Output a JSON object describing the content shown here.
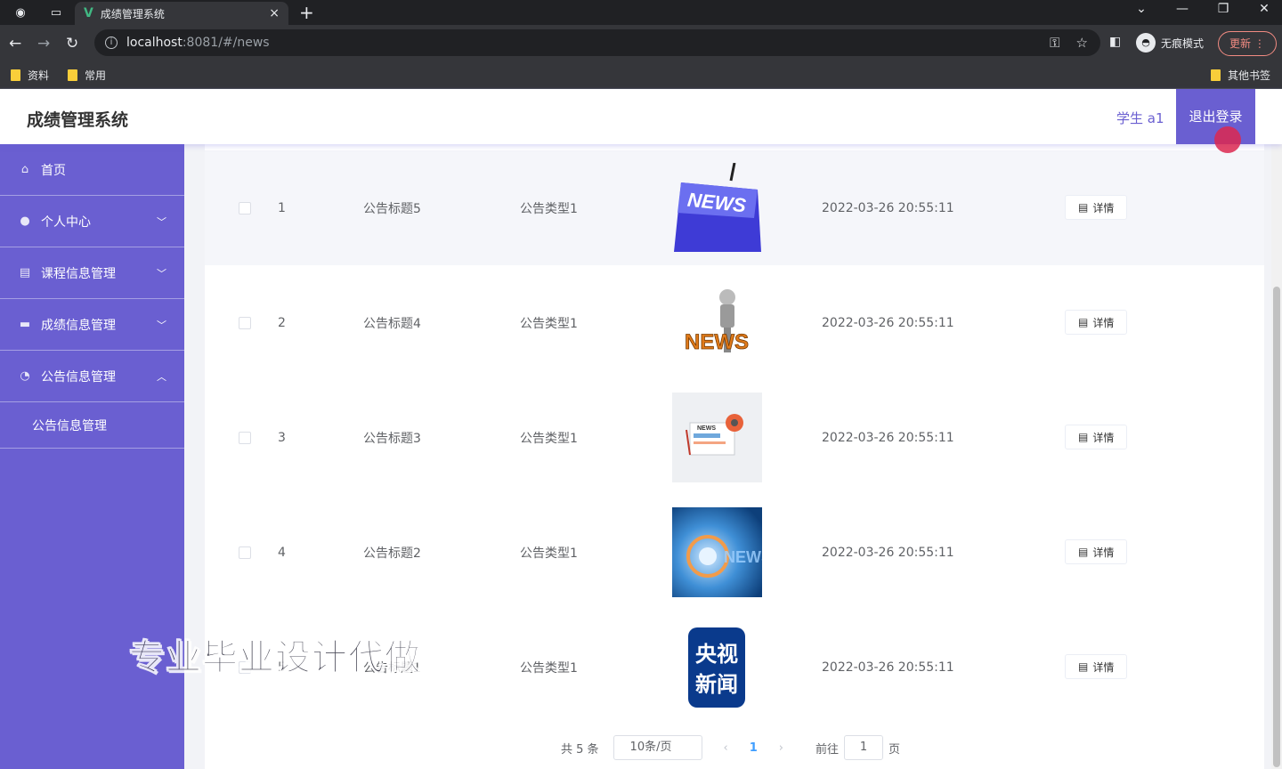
{
  "browser": {
    "tab_title": "成绩管理系统",
    "tab_close": "×",
    "new_tab": "+",
    "url_host": "localhost",
    "url_rest": ":8081/#/news",
    "incognito_label": "无痕模式",
    "update_label": "更新",
    "bookmarks": [
      "资料",
      "常用"
    ],
    "other_bookmarks": "其他书签"
  },
  "header": {
    "brand": "成绩管理系统",
    "user": "学生 a1",
    "logout": "退出登录"
  },
  "sidebar": {
    "items": [
      {
        "label": "首页",
        "icon": "home-icon"
      },
      {
        "label": "个人中心",
        "icon": "user-icon",
        "arrow": "﹀"
      },
      {
        "label": "课程信息管理",
        "icon": "book-icon",
        "arrow": "﹀"
      },
      {
        "label": "成绩信息管理",
        "icon": "grade-icon",
        "arrow": "﹀"
      },
      {
        "label": "公告信息管理",
        "icon": "notice-icon",
        "arrow": "︿"
      }
    ],
    "sub_item": "公告信息管理"
  },
  "table": {
    "rows": [
      {
        "index": "1",
        "title": "公告标题5",
        "type": "公告类型1",
        "image": "news-key-image",
        "time": "2022-03-26 20:55:11",
        "action": "详情"
      },
      {
        "index": "2",
        "title": "公告标题4",
        "type": "公告类型1",
        "image": "news-3d-image",
        "time": "2022-03-26 20:55:11",
        "action": "详情"
      },
      {
        "index": "3",
        "title": "公告标题3",
        "type": "公告类型1",
        "image": "news-paper-image",
        "time": "2022-03-26 20:55:11",
        "action": "详情"
      },
      {
        "index": "4",
        "title": "公告标题2",
        "type": "公告类型1",
        "image": "news-blue-image",
        "time": "2022-03-26 20:55:11",
        "action": "详情"
      },
      {
        "index": "5",
        "title": "公告标题1",
        "type": "公告类型1",
        "image": "cctv-news-image",
        "time": "2022-03-26 20:55:11",
        "action": "详情"
      }
    ],
    "logo_texts": {
      "key": "NEWS",
      "news3d": "NEWS",
      "paper": "NEWS",
      "blue": "NEWS",
      "cctv_top": "央视",
      "cctv_bottom": "新闻"
    }
  },
  "pagination": {
    "total": "共 5 条",
    "page_size": "10条/页",
    "current": "1",
    "goto_prefix": "前往",
    "goto_value": "1",
    "goto_suffix": "页"
  },
  "watermark": "专业毕业设计代做",
  "colors": {
    "accent": "#6a5fd1",
    "sidebar": "#6a5fd1"
  }
}
